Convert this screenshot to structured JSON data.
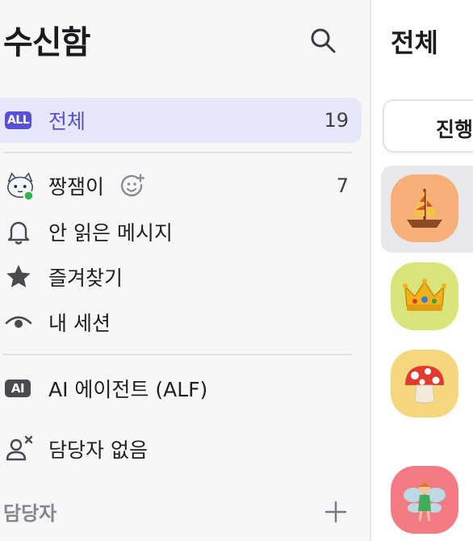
{
  "sidebar": {
    "title": "수신함",
    "items": [
      {
        "label": "전체",
        "count": "19",
        "badge": "ALL"
      },
      {
        "label": "짱잼이",
        "count": "7"
      },
      {
        "label": "안 읽은 메시지"
      },
      {
        "label": "즐겨찾기"
      },
      {
        "label": "내 세션"
      },
      {
        "label": "AI 에이전트 (ALF)",
        "badge": "AI"
      },
      {
        "label": "담당자 없음"
      }
    ],
    "section": "담당자"
  },
  "main": {
    "title": "전체",
    "tab_label": "진행중",
    "avatars": [
      {
        "icon": "sailboat-icon",
        "bg": "#f7b07a"
      },
      {
        "icon": "crown-icon",
        "bg": "#d9e57a"
      },
      {
        "icon": "mushroom-icon",
        "bg": "#f5d77e"
      },
      {
        "icon": "fairy-icon",
        "bg": "#f47b84"
      }
    ]
  },
  "colors": {
    "accent": "#5651d6",
    "selected_bg": "#e7e6fb",
    "online": "#2fb34a",
    "sidebar_bg": "#f7f7f8"
  }
}
